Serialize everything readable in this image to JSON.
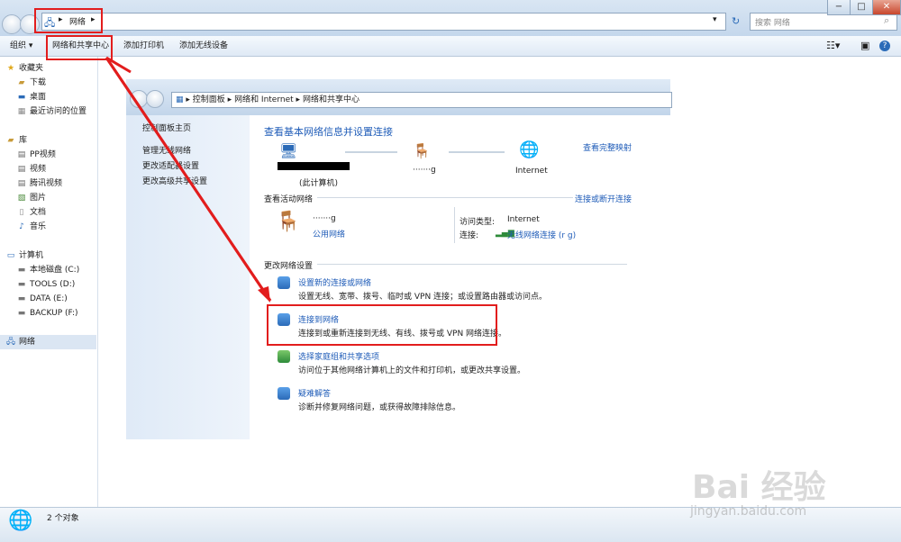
{
  "window": {
    "address_crumb": "网络",
    "search_placeholder": "搜索 网络",
    "controls": {
      "min": "−",
      "max": "□",
      "close": "✕"
    }
  },
  "toolbar": {
    "organize": "组织 ▾",
    "network_center": "网络和共享中心",
    "add_printer": "添加打印机",
    "add_wireless": "添加无线设备"
  },
  "nav": {
    "favorites": "收藏夹",
    "downloads": "下载",
    "desktop": "桌面",
    "recent": "最近访问的位置",
    "libraries": "库",
    "pp": "PP视频",
    "video": "视频",
    "tencent": "腾讯视频",
    "pictures": "图片",
    "docs": "文档",
    "music": "音乐",
    "computer": "计算机",
    "drive_c": "本地磁盘 (C:)",
    "drive_d": "TOOLS (D:)",
    "drive_e": "DATA (E:)",
    "drive_f": "BACKUP (F:)",
    "network": "网络"
  },
  "status": {
    "count": "2 个对象"
  },
  "inner": {
    "crumb1": "控制面板",
    "crumb2": "网络和 Internet",
    "crumb3": "网络和共享中心",
    "side": {
      "home": "控制面板主页",
      "wireless": "管理无线网络",
      "adapter": "更改适配器设置",
      "advanced": "更改高级共享设置"
    },
    "heading": "查看基本网络信息并设置连接",
    "full_map": "查看完整映射",
    "this_pc": "(此计算机)",
    "internet": "Internet",
    "net_dots": "·······g",
    "active_title": "查看活动网络",
    "connect_disconnect": "连接或断开连接",
    "net_name": "·······g",
    "public_net": "公用网络",
    "access_type_label": "访问类型:",
    "access_type_value": "Internet",
    "conn_label": "连接:",
    "conn_value": "无线网络连接 (r     g)",
    "change_title": "更改网络设置",
    "items": [
      {
        "title": "设置新的连接或网络",
        "desc": "设置无线、宽带、拨号、临时或 VPN 连接；或设置路由器或访问点。"
      },
      {
        "title": "连接到网络",
        "desc": "连接到或重新连接到无线、有线、拨号或 VPN 网络连接。"
      },
      {
        "title": "选择家庭组和共享选项",
        "desc": "访问位于其他网络计算机上的文件和打印机，或更改共享设置。"
      },
      {
        "title": "疑难解答",
        "desc": "诊断并修复网络问题，或获得故障排除信息。"
      }
    ]
  },
  "watermark": {
    "brand": "Bai  经验",
    "url": "jingyan.baidu.com"
  }
}
